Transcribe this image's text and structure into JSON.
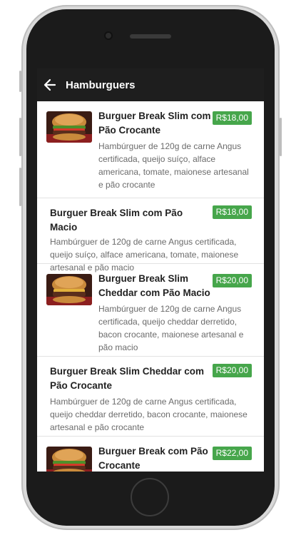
{
  "app": {
    "title": "Hamburguers"
  },
  "items": [
    {
      "name": "Burguer Break Slim com Pão Crocante",
      "price": "R$18,00",
      "description": "Hambúrguer de 120g de carne Angus certificada, queijo suíço, alface americana, tomate, maionese artesanal e pão crocante",
      "has_image": true
    },
    {
      "name": "Burguer Break Slim com Pão Macio",
      "price": "R$18,00",
      "description": "Hambúrguer de 120g de carne Angus certificada, queijo suíço, alface americana, tomate, maionese artesanal e pão macio",
      "has_image": false
    },
    {
      "name": "Burguer Break Slim Cheddar com Pão Macio",
      "price": "R$20,00",
      "description": "Hambúrguer de 120g de carne Angus certificada, queijo cheddar derretido, bacon crocante, maionese artesanal e pão macio",
      "has_image": true
    },
    {
      "name": "Burguer Break Slim Cheddar com Pão Crocante",
      "price": "R$20,00",
      "description": "Hambúrguer de 120g de carne Angus certificada, queijo cheddar derretido, bacon crocante, maionese artesanal e pão crocante",
      "has_image": false
    },
    {
      "name": "Burguer Break com Pão Crocante",
      "price": "R$22,00",
      "description": "",
      "has_image": true
    }
  ],
  "colors": {
    "appbar": "#1e1e1e",
    "price_badge": "#46a64b"
  },
  "icons": {
    "back": "arrow-left-icon"
  }
}
